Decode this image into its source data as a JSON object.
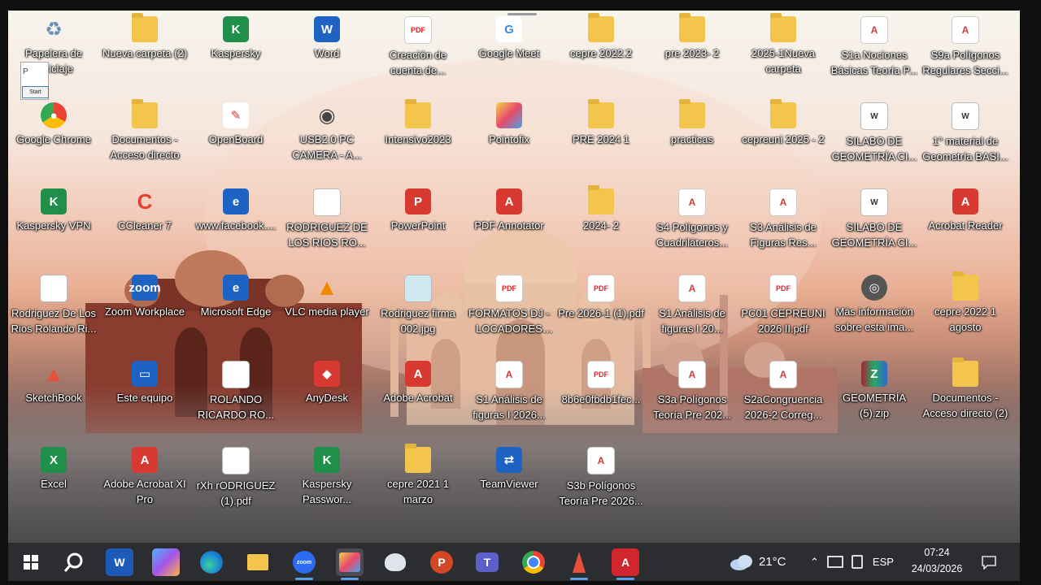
{
  "desktop": {
    "icons": [
      {
        "label": "Papelera de reciclaje",
        "icon": "recycle-bin-icon"
      },
      {
        "label": "Nueva carpeta (2)",
        "icon": "folder-icon"
      },
      {
        "label": "Kaspersky",
        "icon": "kaspersky-icon"
      },
      {
        "label": "Word",
        "icon": "word-icon"
      },
      {
        "label": "Creación de cuenta de...",
        "icon": "pdf-file-icon"
      },
      {
        "label": "Google Meet",
        "icon": "google-meet-icon"
      },
      {
        "label": "cepre 2022.2",
        "icon": "folder-icon"
      },
      {
        "label": "pre 2023- 2",
        "icon": "folder-icon"
      },
      {
        "label": "2025-1Nueva carpeta",
        "icon": "folder-icon"
      },
      {
        "label": "S1a Nociones Básicas Teoría P...",
        "icon": "pdf-annotator-file-icon"
      },
      {
        "label": "S9a Polígonos Regulares Secci...",
        "icon": "pdf-annotator-file-icon"
      },
      {
        "label": "Google Chrome",
        "icon": "chrome-icon"
      },
      {
        "label": "Documentos - Acceso directo",
        "icon": "folder-shortcut-icon"
      },
      {
        "label": "OpenBoard",
        "icon": "openboard-icon"
      },
      {
        "label": "USB2.0 PC CAMERA - A...",
        "icon": "webcam-icon"
      },
      {
        "label": "Intensivo2023",
        "icon": "folder-icon"
      },
      {
        "label": "Pointofix",
        "icon": "pointofix-icon"
      },
      {
        "label": "PRE 2024 1",
        "icon": "folder-icon"
      },
      {
        "label": "practicas",
        "icon": "folder-icon"
      },
      {
        "label": "cepreuni 2025 - 2",
        "icon": "folder-icon"
      },
      {
        "label": "SILABO DE GEOMETRÍA CI...",
        "icon": "word-file-icon"
      },
      {
        "label": "1° material de Geometría BASI...",
        "icon": "word-file-icon"
      },
      {
        "label": "Kaspersky VPN",
        "icon": "kaspersky-vpn-icon"
      },
      {
        "label": "CCleaner 7",
        "icon": "ccleaner-icon"
      },
      {
        "label": "www.facebook....",
        "icon": "edge-icon"
      },
      {
        "label": "RODRIGUEZ DE LOS RIOS RO...",
        "icon": "document-icon"
      },
      {
        "label": "PowerPoint",
        "icon": "powerpoint-icon"
      },
      {
        "label": "PDF Annotator",
        "icon": "pdf-annotator-icon"
      },
      {
        "label": "2024- 2",
        "icon": "folder-icon"
      },
      {
        "label": "S4 Polígonos y Cuadriláteros...",
        "icon": "pdf-annotator-file-icon"
      },
      {
        "label": "S3 Análisis de Figuras Res...",
        "icon": "pdf-annotator-file-icon"
      },
      {
        "label": "SILABO DE GEOMETRÍA CI...",
        "icon": "word-file-icon"
      },
      {
        "label": "Acrobat Reader",
        "icon": "acrobat-icon"
      },
      {
        "label": "Rodriguez De Los Rios Rolando Ri...",
        "icon": "document-icon"
      },
      {
        "label": "Zoom Workplace",
        "icon": "zoom-icon"
      },
      {
        "label": "Microsoft Edge",
        "icon": "edge-icon"
      },
      {
        "label": "VLC media player",
        "icon": "vlc-icon"
      },
      {
        "label": "Rodriguez firma 002.jpg",
        "icon": "image-file-icon"
      },
      {
        "label": "FORMATOS DJ - LOCADORES 20...",
        "icon": "pdf-file-icon"
      },
      {
        "label": "Pre 2026-1 (1).pdf",
        "icon": "pdf-file-icon"
      },
      {
        "label": "S1 Análisis de figuras I 20...",
        "icon": "pdf-annotator-file-icon"
      },
      {
        "label": "PC01 CEPREUNI 2026 II.pdf",
        "icon": "pdf-file-icon"
      },
      {
        "label": "Más información sobre esta ima...",
        "icon": "camera-icon"
      },
      {
        "label": "cepre 2022 1 agosto",
        "icon": "folder-icon"
      },
      {
        "label": "SketchBook",
        "icon": "sketchbook-icon"
      },
      {
        "label": "Este equipo",
        "icon": "computer-icon"
      },
      {
        "label": "ROLANDO RICARDO RO...",
        "icon": "document-icon"
      },
      {
        "label": "AnyDesk",
        "icon": "anydesk-icon"
      },
      {
        "label": "Adobe Acrobat",
        "icon": "acrobat-icon"
      },
      {
        "label": "S1 Análisis de figuras I 2026...",
        "icon": "pdf-annotator-file-icon"
      },
      {
        "label": "8b6e0fbdb1fec...",
        "icon": "pdf-file-icon"
      },
      {
        "label": "S3a Polígonos Teoría Pre 202...",
        "icon": "pdf-annotator-file-icon"
      },
      {
        "label": "S2aCongruencia 2026-2 Correg...",
        "icon": "pdf-annotator-file-icon"
      },
      {
        "label": "GEOMETRÍA (5).zip",
        "icon": "zip-icon"
      },
      {
        "label": "Documentos - Acceso directo (2)",
        "icon": "folder-shortcut-icon"
      },
      {
        "label": "Excel",
        "icon": "excel-icon"
      },
      {
        "label": "Adobe Acrobat XI Pro",
        "icon": "acrobat-icon"
      },
      {
        "label": "rXh rODRIGUEZ (1).pdf",
        "icon": "document-icon"
      },
      {
        "label": "Kaspersky Passwor...",
        "icon": "kaspersky-password-icon"
      },
      {
        "label": "cepre 2021 1 marzo",
        "icon": "folder-icon"
      },
      {
        "label": "TeamViewer",
        "icon": "teamviewer-icon"
      },
      {
        "label": "S3b Polígonos Teoría Pre 2026...",
        "icon": "pdf-annotator-file-icon"
      }
    ],
    "overlay_start_label": "Start",
    "overlay_p": "P"
  },
  "taskbar": {
    "apps": [
      {
        "name": "start-icon",
        "active": false
      },
      {
        "name": "search-icon",
        "active": false
      },
      {
        "name": "word-icon",
        "active": false
      },
      {
        "name": "copilot-icon",
        "active": false
      },
      {
        "name": "edge-icon",
        "active": false
      },
      {
        "name": "file-explorer-icon",
        "active": false
      },
      {
        "name": "zoom-icon",
        "active": true
      },
      {
        "name": "pointofix-icon",
        "active": true
      },
      {
        "name": "openboard-icon",
        "active": false
      },
      {
        "name": "powerpoint-icon",
        "active": false
      },
      {
        "name": "teams-icon",
        "active": false
      },
      {
        "name": "chrome-icon",
        "active": false
      },
      {
        "name": "sketchbook-icon",
        "active": false
      },
      {
        "name": "pdf-annotator-icon",
        "active": true
      }
    ],
    "zoom_label": "zoom",
    "weather": "21°C",
    "language": "ESP",
    "time": "07:24",
    "date": "24/03/2026"
  }
}
